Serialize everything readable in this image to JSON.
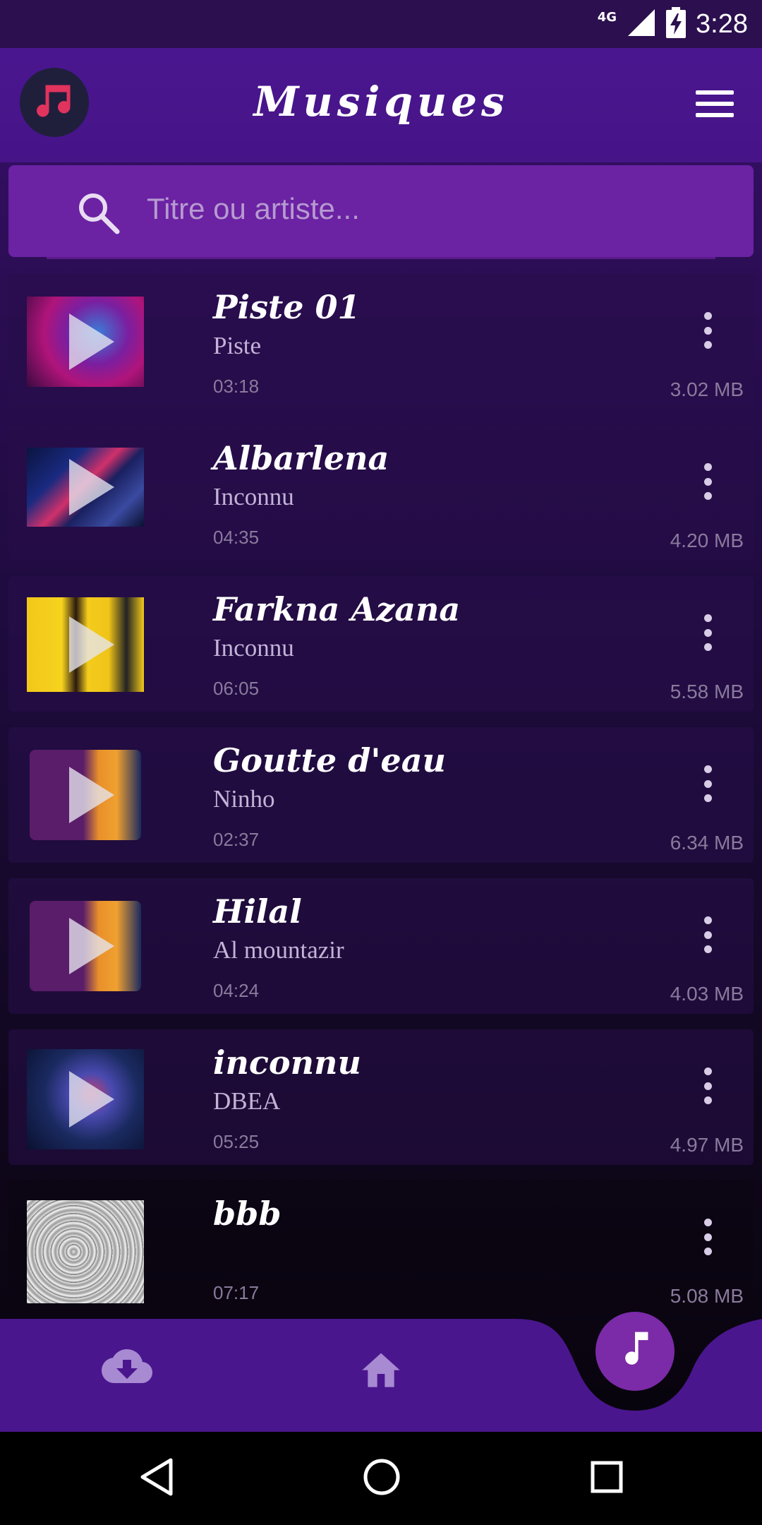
{
  "status_bar": {
    "network": "4G",
    "time": "3:28"
  },
  "header": {
    "title": "Musiques"
  },
  "search": {
    "placeholder": "Titre ou artiste..."
  },
  "songs": [
    {
      "title": "Piste 01",
      "artist": "Piste",
      "duration": "03:18",
      "size": "3.02 MB"
    },
    {
      "title": "Albarlena",
      "artist": "Inconnu",
      "duration": "04:35",
      "size": "4.20 MB"
    },
    {
      "title": "Farkna Azana",
      "artist": "Inconnu",
      "duration": "06:05",
      "size": "5.58 MB"
    },
    {
      "title": "Goutte d'eau",
      "artist": "Ninho",
      "duration": "02:37",
      "size": "6.34 MB"
    },
    {
      "title": "Hilal",
      "artist": "Al mountazir",
      "duration": "04:24",
      "size": "4.03 MB"
    },
    {
      "title": "inconnu",
      "artist": "DBEA",
      "duration": "05:25",
      "size": "4.97 MB"
    },
    {
      "title": "bbb",
      "artist": "",
      "duration": "07:17",
      "size": "5.08 MB"
    }
  ],
  "bottom_nav": {
    "items": [
      {
        "icon": "cloud-download-icon"
      },
      {
        "icon": "home-icon"
      },
      {
        "icon": "music-note-icon",
        "active": true
      }
    ]
  },
  "colors": {
    "header": "#461487",
    "search": "#6b22a3",
    "accent": "#7b2aa8",
    "logo_note": "#e0335d"
  }
}
